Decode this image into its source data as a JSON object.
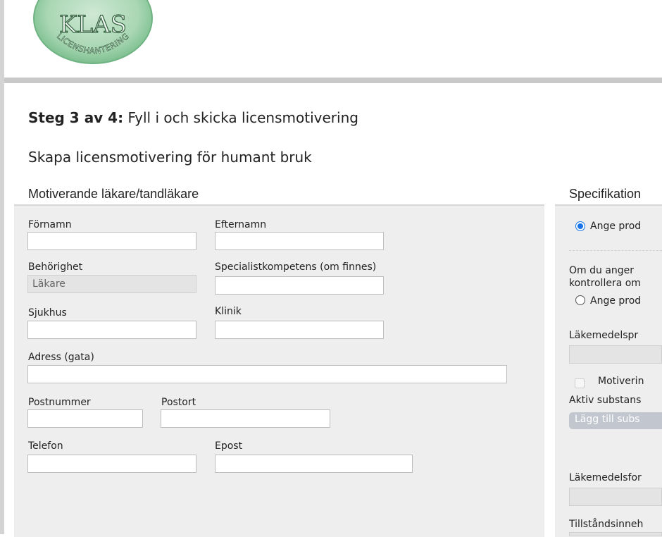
{
  "logo": {
    "line1": "KLAS",
    "line2": "LICENSHANTERING"
  },
  "page": {
    "step_label": "Steg 3 av 4:",
    "step_text": " Fyll i och skicka licensmotivering",
    "subtitle": "Skapa licensmotivering för humant bruk"
  },
  "doctor_section": {
    "heading": "Motiverande läkare/tandläkare",
    "fields": {
      "fornamn": {
        "label": "Förnamn",
        "value": ""
      },
      "efternamn": {
        "label": "Efternamn",
        "value": ""
      },
      "behorighet": {
        "label": "Behörighet",
        "value": "Läkare"
      },
      "specialist": {
        "label": "Specialistkompetens (om finnes)",
        "value": ""
      },
      "sjukhus": {
        "label": "Sjukhus",
        "value": ""
      },
      "klinik": {
        "label": "Klinik",
        "value": ""
      },
      "adress": {
        "label": "Adress (gata)",
        "value": ""
      },
      "postnummer": {
        "label": "Postnummer",
        "value": ""
      },
      "postort": {
        "label": "Postort",
        "value": ""
      },
      "telefon": {
        "label": "Telefon",
        "value": ""
      },
      "epost": {
        "label": "Epost",
        "value": ""
      }
    }
  },
  "spec_section": {
    "heading": "Specifikation",
    "radio1_label": "Ange prod",
    "radio1_selected": true,
    "info_line1": "Om du anger",
    "info_line2": "kontrollera om",
    "radio2_label": "Ange prod",
    "radio2_selected": false,
    "lakemedelsprodukt_label": "Läkemedelspr",
    "motivering_label": "Motiverin",
    "motivering_checked": false,
    "aktiv_substans_label": "Aktiv substans",
    "add_substance_button": "Lägg till subs",
    "lakemedelsform_label": "Läkemedelsfor",
    "tillstandsinnehavare_label": "Tillståndsinneh"
  },
  "colors": {
    "panel_bg": "#eeeeee",
    "divider": "#c9c9c9",
    "radio_accent": "#1a73e8",
    "logo_green": "#7dbf8e",
    "disabled_button": "#c2c7cf"
  }
}
